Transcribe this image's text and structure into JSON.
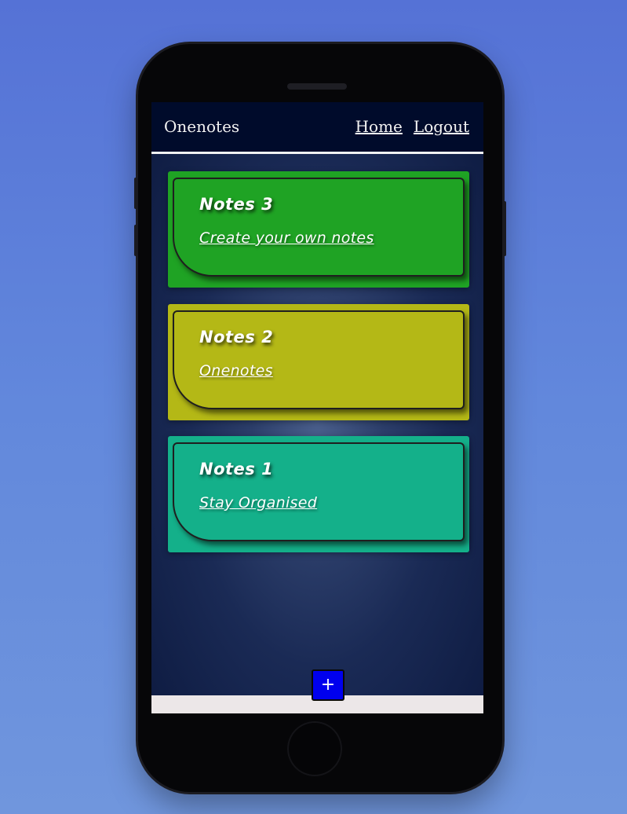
{
  "navbar": {
    "brand": "Onenotes",
    "links": [
      {
        "label": "Home "
      },
      {
        "label": "Logout"
      }
    ]
  },
  "notes": [
    {
      "title": "Notes 3",
      "subtitle": "Create your own notes",
      "color": "#1fa324"
    },
    {
      "title": "Notes 2",
      "subtitle": "Onenotes",
      "color": "#b4b816"
    },
    {
      "title": "Notes 1",
      "subtitle": "Stay Organised",
      "color": "#14b08a"
    }
  ],
  "add_button": {
    "label": "+",
    "icon": "plus-icon",
    "color": "#0000ee"
  },
  "colors": {
    "navbar": "#000b2b",
    "background": "#5a78d8"
  }
}
